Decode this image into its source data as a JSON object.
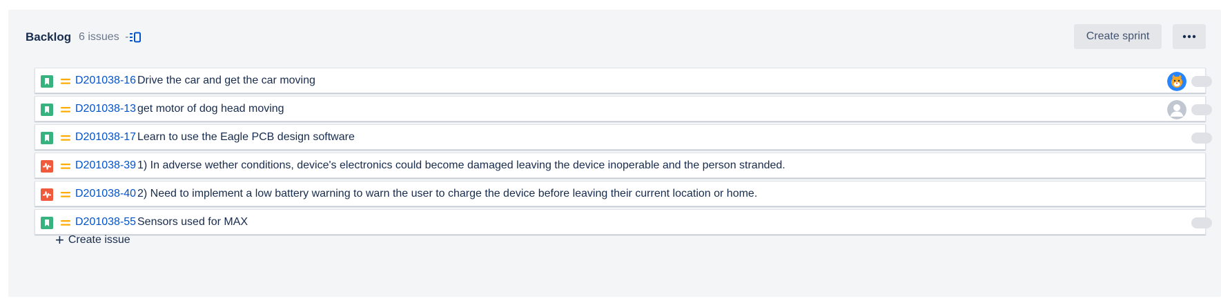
{
  "backlog": {
    "title": "Backlog",
    "issue_count": "6 issues",
    "separator": "-",
    "board_icon": "board-view-icon",
    "create_sprint_label": "Create sprint",
    "more_icon": "more-horizontal-icon"
  },
  "issues": [
    {
      "key": "D201038-16",
      "summary": "Drive the car and get the car moving",
      "type": "story",
      "priority": "medium",
      "assignee": "cat-avatar"
    },
    {
      "key": "D201038-13",
      "summary": "get motor of dog head moving",
      "type": "story",
      "priority": "medium",
      "assignee": "default-avatar"
    },
    {
      "key": "D201038-17",
      "summary": "Learn to use the Eagle PCB design software",
      "type": "story",
      "priority": "medium",
      "assignee": ""
    },
    {
      "key": "D201038-39",
      "summary": "1) In adverse wether conditions, device's electronics could become damaged leaving the device inoperable and the person stranded.",
      "type": "bug",
      "priority": "medium",
      "assignee": ""
    },
    {
      "key": "D201038-40",
      "summary": "2) Need to implement a low battery warning to warn the user to charge the device before leaving their current location or home.",
      "type": "bug",
      "priority": "medium",
      "assignee": ""
    },
    {
      "key": "D201038-55",
      "summary": "Sensors used for MAX",
      "type": "story",
      "priority": "medium",
      "assignee": ""
    }
  ],
  "create_issue": {
    "label": "Create issue",
    "icon": "plus-icon"
  },
  "colors": {
    "story": "#36b37e",
    "bug": "#f05a3c",
    "priority_medium": "#ffab00",
    "link": "#0052cc",
    "panel_bg": "#f4f5f7"
  }
}
